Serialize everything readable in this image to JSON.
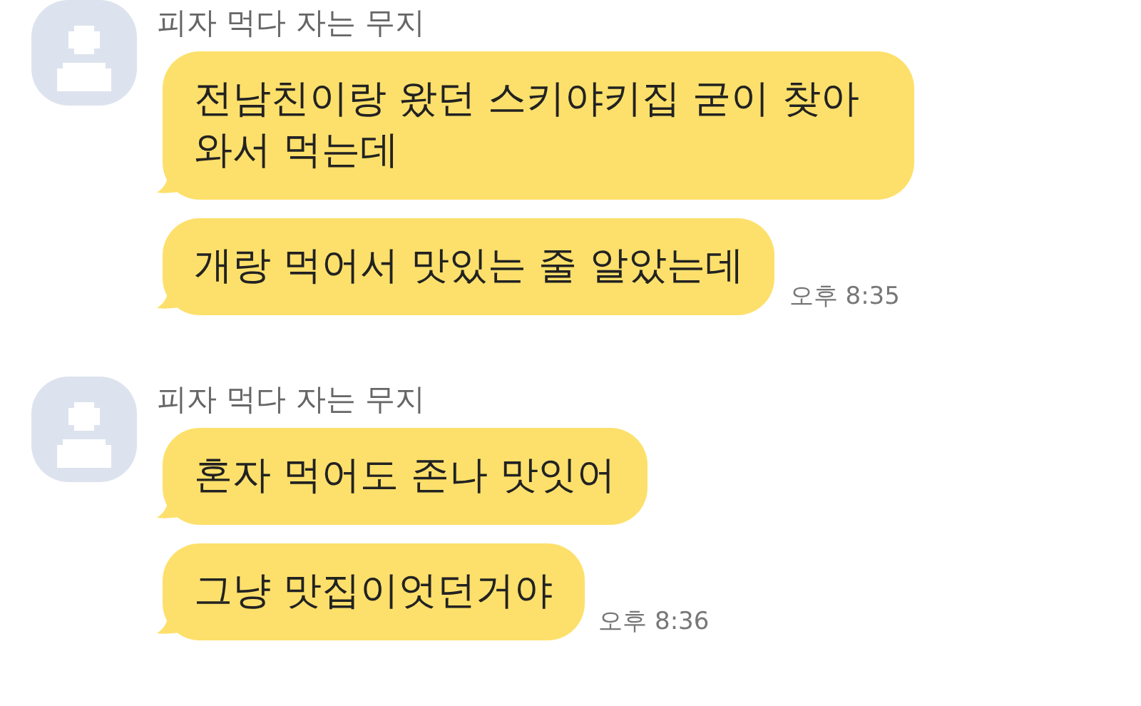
{
  "groups": [
    {
      "sender": "피자 먹다 자는 무지",
      "messages": [
        {
          "text": "전남친이랑 왔던 스키야키집 굳이 찾아 와서 먹는데"
        },
        {
          "text": "개랑 먹어서 맛있는 줄 알았는데"
        }
      ],
      "time": "오후 8:35"
    },
    {
      "sender": "피자 먹다 자는 무지",
      "messages": [
        {
          "text": "혼자 먹어도 존나 맛잇어"
        },
        {
          "text": "그냥 맛집이엇던거야"
        }
      ],
      "time": "오후 8:36"
    }
  ]
}
